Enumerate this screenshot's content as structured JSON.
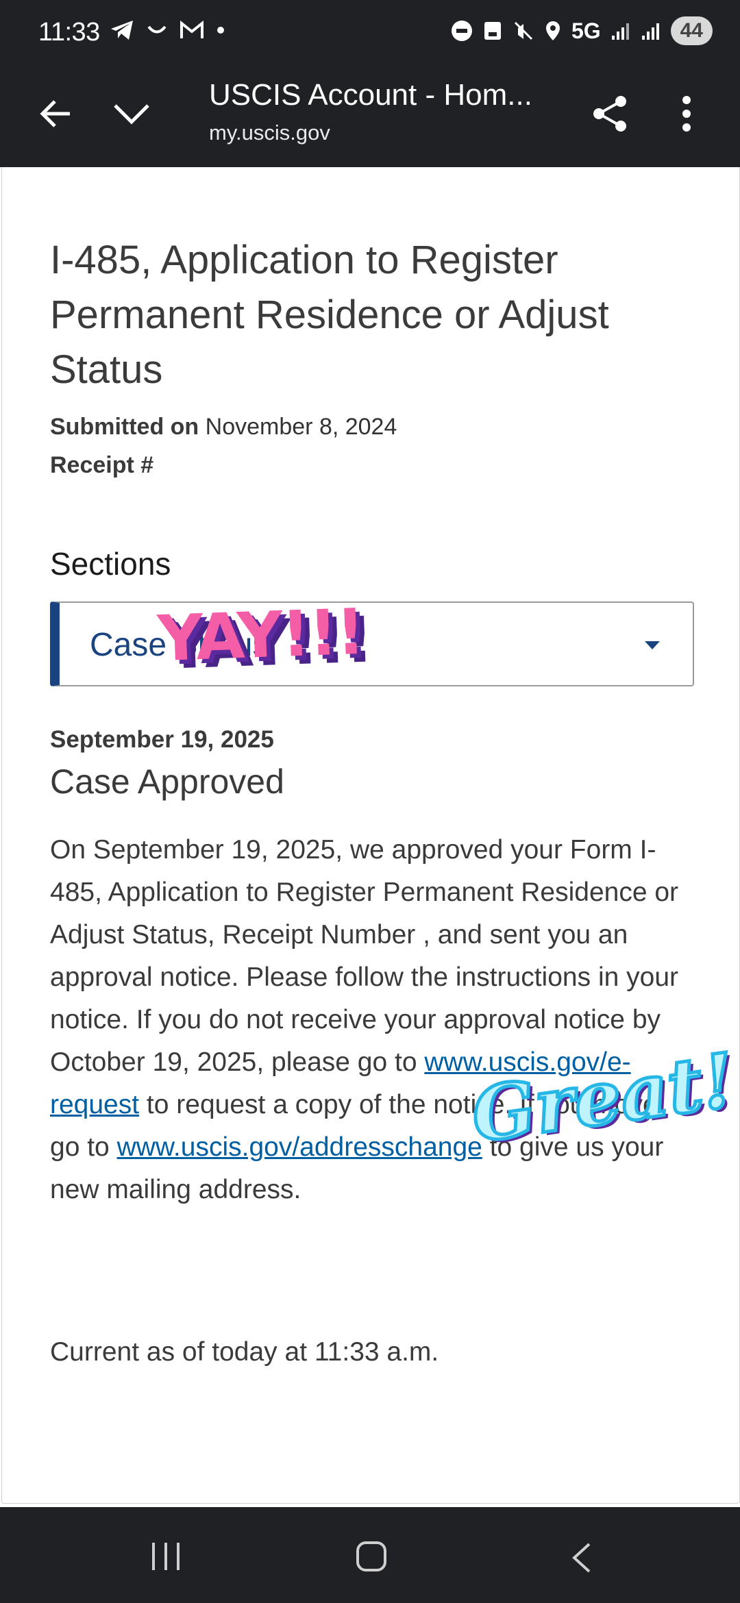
{
  "status_bar": {
    "time": "11:33",
    "network": "5G",
    "battery": "44",
    "left_icons": [
      "telegram-icon",
      "smile-icon",
      "gmail-icon",
      "dot-icon"
    ],
    "right_icons": [
      "dnd-icon",
      "vpn-icon",
      "mute-icon",
      "location-icon",
      "signal-icon",
      "signal-r-icon"
    ]
  },
  "toolbar": {
    "title": "USCIS Account - Hom...",
    "url": "my.uscis.gov"
  },
  "case": {
    "form_title": "I-485, Application to Register Permanent Residence or Adjust Status",
    "submitted_label": "Submitted on",
    "submitted_date": "November 8, 2024",
    "receipt_label": "Receipt #"
  },
  "sections": {
    "label": "Sections",
    "selected": "Case Status"
  },
  "status": {
    "date": "September 19, 2025",
    "title": "Case Approved",
    "body_1": "On September 19, 2025, we approved your Form I-485, Application to Register Permanent Residence or Adjust Status, Receipt Number ",
    "body_2": ", and sent you an approval notice. Please follow the instructions in your notice. If you do not receive your approval notice by October 19, 2025, please go to ",
    "link_1": "www.uscis.gov/e-request",
    "body_3": " to request a copy of the notice. If you move, go to ",
    "link_2": "www.uscis.gov/addresschange",
    "body_4": " to give us your new mailing address.",
    "current": "Current as of today at 11:33 a.m."
  },
  "stickers": {
    "yay": "YAY!!!",
    "great": "Great!"
  },
  "colors": {
    "accent": "#1a4480",
    "link": "#005ea2",
    "chrome": "#202124"
  }
}
